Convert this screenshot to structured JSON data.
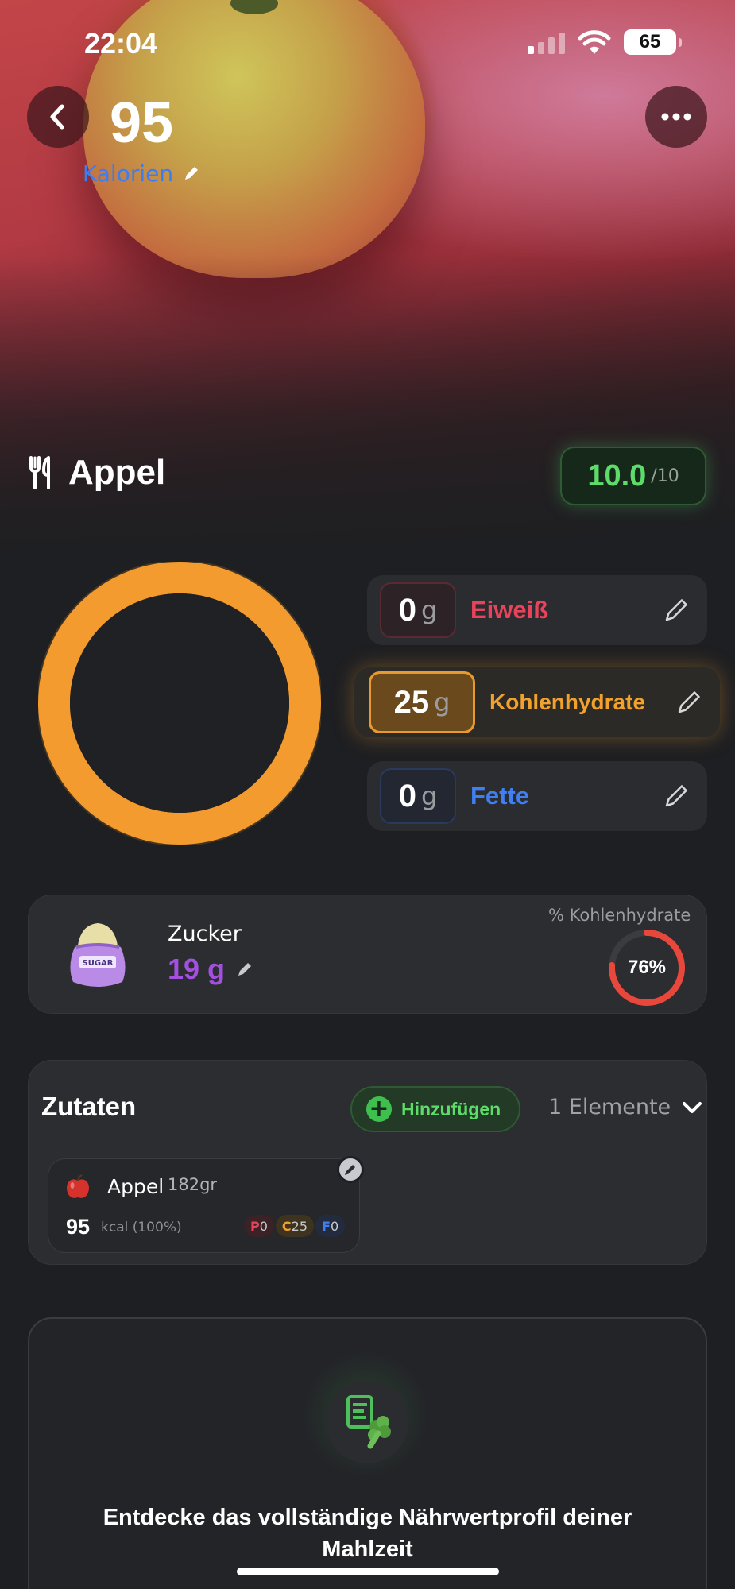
{
  "status": {
    "time": "22:04",
    "battery": "65"
  },
  "header": {
    "food_name": "Appel",
    "score": "10.0",
    "score_max": "/10"
  },
  "calories": {
    "value": "95",
    "label": "Kalorien"
  },
  "macros": {
    "protein": {
      "value": "0",
      "unit": "g",
      "label": "Eiweiß",
      "color": "#e8435a"
    },
    "carbs": {
      "value": "25",
      "unit": "g",
      "label": "Kohlenhydrate",
      "color": "#f3a12d"
    },
    "fat": {
      "value": "0",
      "unit": "g",
      "label": "Fette",
      "color": "#3f7ff2"
    }
  },
  "sugar": {
    "title": "Zucker",
    "value": "19 g",
    "pct_label": "% Kohlenhydrate",
    "pct": "76%",
    "pct_value": 0.76
  },
  "ingredients": {
    "title": "Zutaten",
    "add_label": "Hinzufügen",
    "count_label": "1 Elemente",
    "items": [
      {
        "name": "Appel",
        "weight": "182gr",
        "kcal": "95",
        "kcal_unit": "kcal (100%)",
        "p_letter": "P",
        "p_val": "0",
        "c_letter": "C",
        "c_val": "25",
        "f_letter": "F",
        "f_val": "0"
      }
    ]
  },
  "promo": {
    "text": "Entdecke das vollständige Nährwertprofil deiner Mahlzeit"
  }
}
